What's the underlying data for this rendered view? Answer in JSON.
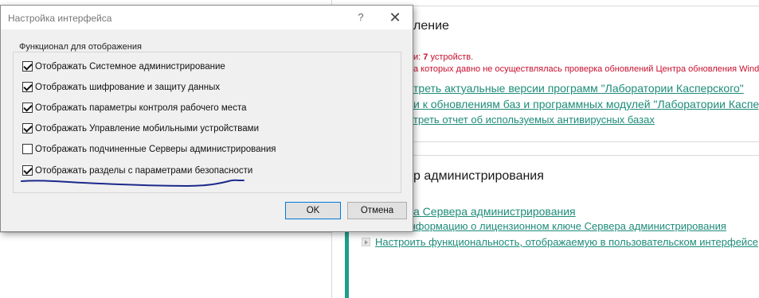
{
  "background": {
    "section1": {
      "heading": "ление",
      "warn_prefix": "и: ",
      "warn_count": "7",
      "warn_suffix": " устройств.",
      "warn_line2": "а которых давно не осуществлялась проверка обновлений Центра обновления Windo",
      "links": [
        "треть актуальные версии программ \"Лаборатории Касперского\"",
        "и к обновлениям баз и программных модулей \"Лаборатории Каспер",
        "треть отчет об используемых антивирусных базах"
      ]
    },
    "section2": {
      "heading": "р администрирования",
      "links": [
        "а Сервера администрирования",
        "треть информацию о лицензионном ключе Сервера администрирования",
        "Настроить функциональность, отображаемую в пользовательском интерфейсе"
      ]
    }
  },
  "dialog": {
    "title": "Настройка интерфейса",
    "help_glyph": "?",
    "close_glyph": "✕",
    "group_title": "Функционал для отображения",
    "options": [
      {
        "label": "Отображать Системное администрирование",
        "checked": true
      },
      {
        "label": "Отображать шифрование и защиту данных",
        "checked": true
      },
      {
        "label": "Отображать параметры контроля рабочего места",
        "checked": true
      },
      {
        "label": "Отображать Управление мобильными устройствами",
        "checked": true
      },
      {
        "label": "Отображать подчиненные Серверы администрирования",
        "checked": false
      },
      {
        "label": "Отображать разделы с параметрами безопасности",
        "checked": true
      }
    ],
    "ok_label": "OK",
    "cancel_label": "Отмена"
  },
  "colors": {
    "link": "#1e8c7a",
    "warning": "#c8102e",
    "accent_bar": "#1f9e8c",
    "annotation_stroke": "#1c2a8c"
  }
}
